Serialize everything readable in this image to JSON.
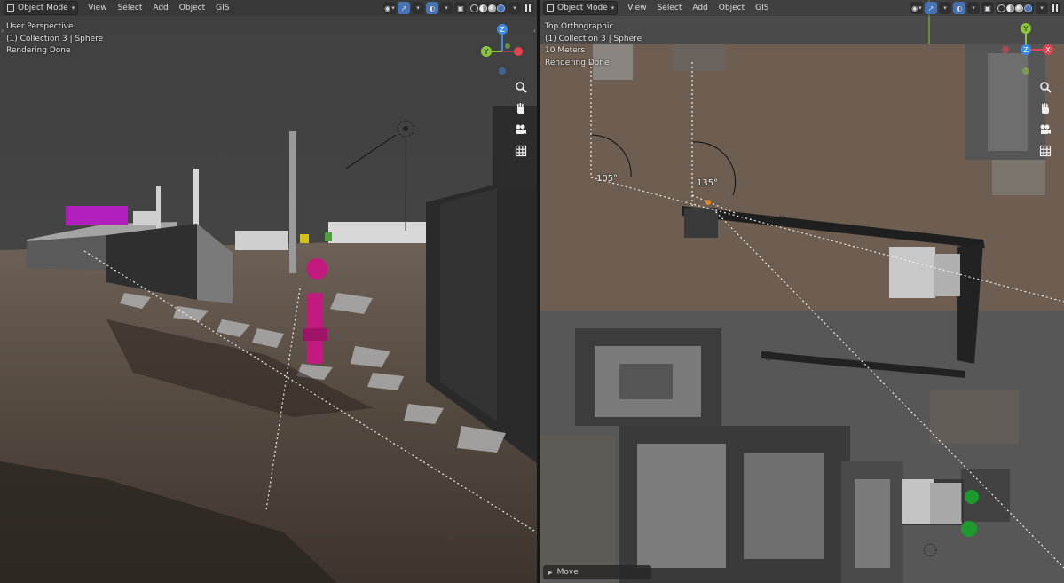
{
  "left_viewport": {
    "header": {
      "mode": "Object Mode",
      "menus": [
        "View",
        "Select",
        "Add",
        "Object",
        "GIS"
      ]
    },
    "overlay": {
      "view_name": "User Perspective",
      "collection": "(1) Collection 3 | Sphere",
      "status": "Rendering Done"
    },
    "gizmo": {
      "axis_z": "Z",
      "axis_y": "Y"
    }
  },
  "right_viewport": {
    "header": {
      "mode": "Object Mode",
      "menus": [
        "View",
        "Select",
        "Add",
        "Object",
        "GIS"
      ]
    },
    "overlay": {
      "view_name": "Top Orthographic",
      "collection": "(1) Collection 3 | Sphere",
      "scale": "10 Meters",
      "status": "Rendering Done"
    },
    "gizmo": {
      "axis_y": "Y",
      "axis_z": "Z",
      "axis_x": "X"
    },
    "angles": [
      "105°",
      "135°"
    ],
    "last_operator": "Move"
  },
  "icons": {
    "navigation": [
      "zoom-icon",
      "hand-pan-icon",
      "camera-icon",
      "grid-icon"
    ],
    "header": [
      "view-object-types-icon",
      "gizmo-icon",
      "overlay-icon",
      "xray-icon",
      "shading-wireframe-icon",
      "shading-solid-icon",
      "shading-material-icon",
      "shading-rendered-icon",
      "pause-render-icon"
    ]
  },
  "colors": {
    "accent_blue": "#4772b3",
    "axis_x": "#e04452",
    "axis_y": "#8bc53f",
    "axis_z": "#3e8be0",
    "hydrant_magenta": "#c21a7e",
    "building_magenta": "#b21fbf"
  }
}
